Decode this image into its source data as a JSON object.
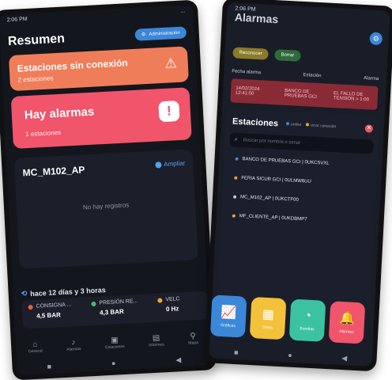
{
  "left_phone": {
    "status": {
      "time": "2:06 PM",
      "right": "..."
    },
    "title": "Resumen",
    "admin_button": "Administración",
    "no_connection": {
      "title": "Estaciones sin conexión",
      "subtitle": "2 estaciones"
    },
    "alarms": {
      "title": "Hay alarmas",
      "subtitle": "1 estaciones"
    },
    "station": {
      "name": "MC_M102_AP",
      "expand": "Ampliar",
      "empty": "No hay registros"
    },
    "since": "hace 12 días y 3 horas",
    "metrics": [
      {
        "label": "CONSIGNA ...",
        "value": "4,5 BAR",
        "color": "#f15a3a"
      },
      {
        "label": "PRESIÓN RE...",
        "value": "4,3 BAR",
        "color": "#3bc26b"
      },
      {
        "label": "VELC",
        "value": "0 Hz",
        "color": "#f1a23a"
      }
    ],
    "nav": [
      "General",
      "Alarmas",
      "Estaciones",
      "Informes",
      "Mapa"
    ]
  },
  "right_phone": {
    "status": {
      "time": "2:06 PM"
    },
    "title": "Alarmas",
    "buttons": [
      "Reconocer",
      "Borrar"
    ],
    "table_headers": [
      "Fecha alarma",
      "Estación",
      "Alarma"
    ],
    "alarm_row": {
      "date": "14/02/2024 12:41:00",
      "station": "BANCO DE PRUEBAS GCI",
      "alarm": "EL FALLO DE TENSIÓN > 1:00"
    },
    "modal": {
      "title": "Estaciones",
      "legend": [
        {
          "label": "online",
          "color": "#3b87d8"
        },
        {
          "label": "error conexión",
          "color": "#f1a23a"
        }
      ],
      "search_placeholder": "Buscar por nombre o serial",
      "stations": [
        {
          "label": "BANCO DE PRUEBAS GCI | 0UKCSVXL",
          "color": "#3b87d8"
        },
        {
          "label": "FERIA SICUR GCI | 0ULMW6UU",
          "color": "#f1a23a"
        },
        {
          "label": "MC_M102_AP | 0UKCTF00",
          "color": "#c4c8d3"
        },
        {
          "label": "MF_CLIENTE_AP | 0UKDBMP7",
          "color": "#f1a23a"
        }
      ]
    },
    "tiles": [
      {
        "label": "Gráficas",
        "color": "#3b87d8"
      },
      {
        "label": "Datos",
        "color": "#f3c13a"
      },
      {
        "label": "Bombas",
        "color": "#3bc2a1"
      },
      {
        "label": "Alarmas",
        "color": "#f0556b"
      }
    ]
  }
}
